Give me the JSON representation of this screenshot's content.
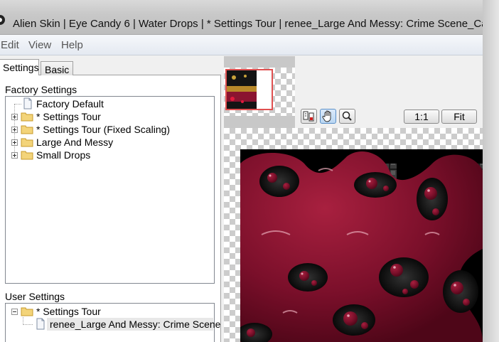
{
  "window": {
    "title": "Alien Skin | Eye Candy 6 | Water Drops | * Settings Tour | renee_Large And Messy: Crime Scene_Carnav"
  },
  "menu": [
    "Edit",
    "View",
    "Help"
  ],
  "tabs": [
    {
      "label": "Settings",
      "active": true
    },
    {
      "label": "Basic",
      "active": false
    }
  ],
  "factory_settings": {
    "heading": "Factory Settings",
    "items": [
      {
        "label": "Factory Default",
        "type": "preset",
        "expandable": false
      },
      {
        "label": "* Settings Tour",
        "type": "folder",
        "expandable": true
      },
      {
        "label": "* Settings Tour (Fixed Scaling)",
        "type": "folder",
        "expandable": true
      },
      {
        "label": "Large And Messy",
        "type": "folder",
        "expandable": true
      },
      {
        "label": "Small Drops",
        "type": "folder",
        "expandable": true
      }
    ]
  },
  "user_settings": {
    "heading": "User Settings",
    "items": [
      {
        "label": "* Settings Tour",
        "type": "folder",
        "expanded": true
      },
      {
        "label": "renee_Large And Messy: Crime Scene",
        "type": "preset",
        "selected": true
      }
    ]
  },
  "preview_toolbar": {
    "tools": [
      {
        "icon": "toggle-preview-icon",
        "active": false
      },
      {
        "icon": "hand-icon",
        "active": true
      },
      {
        "icon": "zoom-icon",
        "active": false
      }
    ],
    "zoom_actual_label": "1:1",
    "fit_label": "Fit"
  },
  "colors": {
    "accent_selection": "#e05050",
    "drop_color": "#7a0f2a",
    "titlebar": "#c9c9c9"
  }
}
